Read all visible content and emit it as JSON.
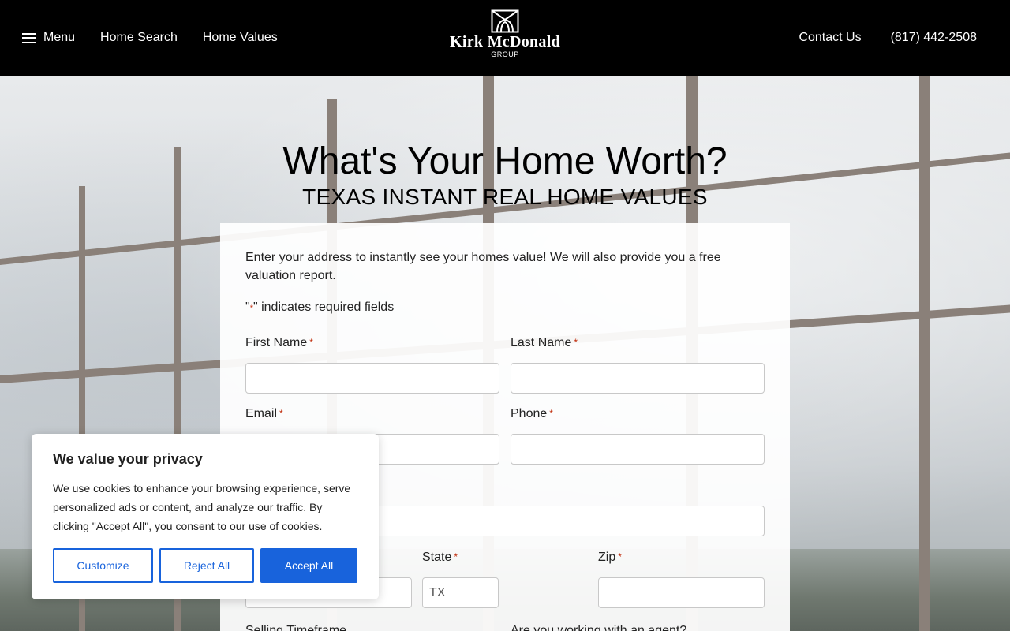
{
  "header": {
    "menu_label": "Menu",
    "nav_left": [
      "Home Search",
      "Home Values"
    ],
    "logo": {
      "name": "Kirk McDonald",
      "sub": "GROUP"
    },
    "contact_label": "Contact Us",
    "phone": "(817) 442-2508"
  },
  "hero": {
    "title": "What's Your Home Worth?",
    "subtitle": "TEXAS INSTANT REAL HOME VALUES"
  },
  "form": {
    "intro": "Enter your address to instantly see your homes value! We will also provide you a free valuation report.",
    "required_note_prefix": "\"",
    "required_note_star": "*",
    "required_note_suffix": "\" indicates required fields",
    "required_mark": "*",
    "first_name_label": "First Name",
    "last_name_label": "Last Name",
    "email_label": "Email",
    "phone_label": "Phone",
    "state_label": "State",
    "state_placeholder": "TX",
    "zip_label": "Zip",
    "selling_timeframe_label": "Selling Timeframe",
    "agent_label": "Are you working with an agent?"
  },
  "cookie": {
    "title": "We value your privacy",
    "text": "We use cookies to enhance your browsing experience, serve personalized ads or content, and analyze our traffic. By clicking \"Accept All\", you consent to our use of cookies.",
    "customize": "Customize",
    "reject": "Reject All",
    "accept": "Accept All"
  },
  "colors": {
    "header_bg": "#000000",
    "required_red": "#c02b0a",
    "cookie_blue": "#1863dc"
  }
}
